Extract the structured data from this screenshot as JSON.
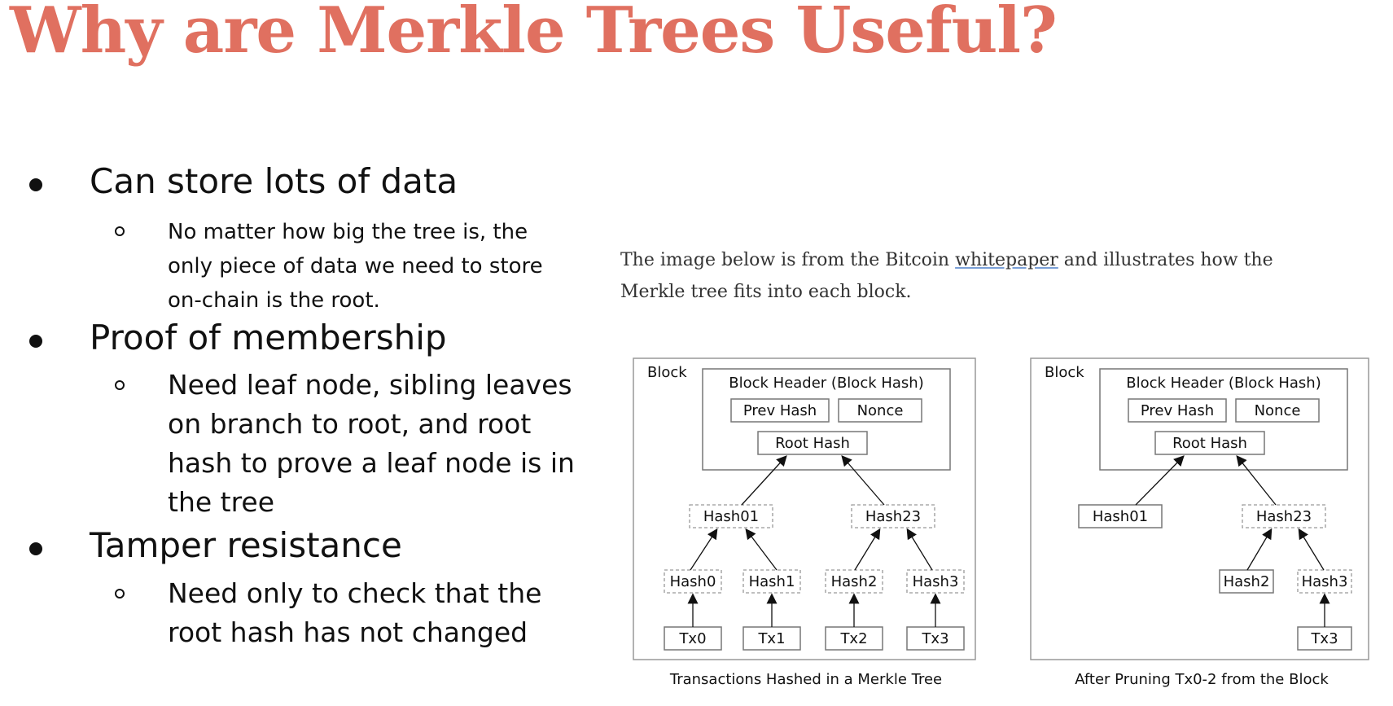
{
  "title": "Why are Merkle Trees Useful?",
  "bullets": [
    {
      "heading": "Can store lots of data",
      "sub_lines": [
        "No matter how big the tree is, the",
        "only piece of data we need to store",
        "on-chain is the root."
      ]
    },
    {
      "heading": "Proof of membership",
      "sub_lines": [
        "Need leaf node, sibling leaves",
        "on branch to root, and root",
        "hash to prove a leaf node is in",
        "the tree"
      ]
    },
    {
      "heading": "Tamper resistance",
      "sub_lines": [
        "Need only to check that the",
        "root hash has not changed"
      ]
    }
  ],
  "intro": {
    "before_link": "The image below is from the Bitcoin ",
    "link_text": "whitepaper",
    "after_link": " and illustrates how the",
    "line2": "Merkle tree fits into each block."
  },
  "diagram_left": {
    "block_label": "Block",
    "header_label": "Block Header (Block Hash)",
    "prev_hash": "Prev Hash",
    "nonce": "Nonce",
    "root_hash": "Root Hash",
    "hash01": "Hash01",
    "hash23": "Hash23",
    "hash0": "Hash0",
    "hash1": "Hash1",
    "hash2": "Hash2",
    "hash3": "Hash3",
    "tx0": "Tx0",
    "tx1": "Tx1",
    "tx2": "Tx2",
    "tx3": "Tx3",
    "caption": "Transactions Hashed in a Merkle Tree"
  },
  "diagram_right": {
    "block_label": "Block",
    "header_label": "Block Header (Block Hash)",
    "prev_hash": "Prev Hash",
    "nonce": "Nonce",
    "root_hash": "Root Hash",
    "hash01": "Hash01",
    "hash23": "Hash23",
    "hash2": "Hash2",
    "hash3": "Hash3",
    "tx3": "Tx3",
    "caption": "After Pruning Tx0-2 from the Block"
  }
}
